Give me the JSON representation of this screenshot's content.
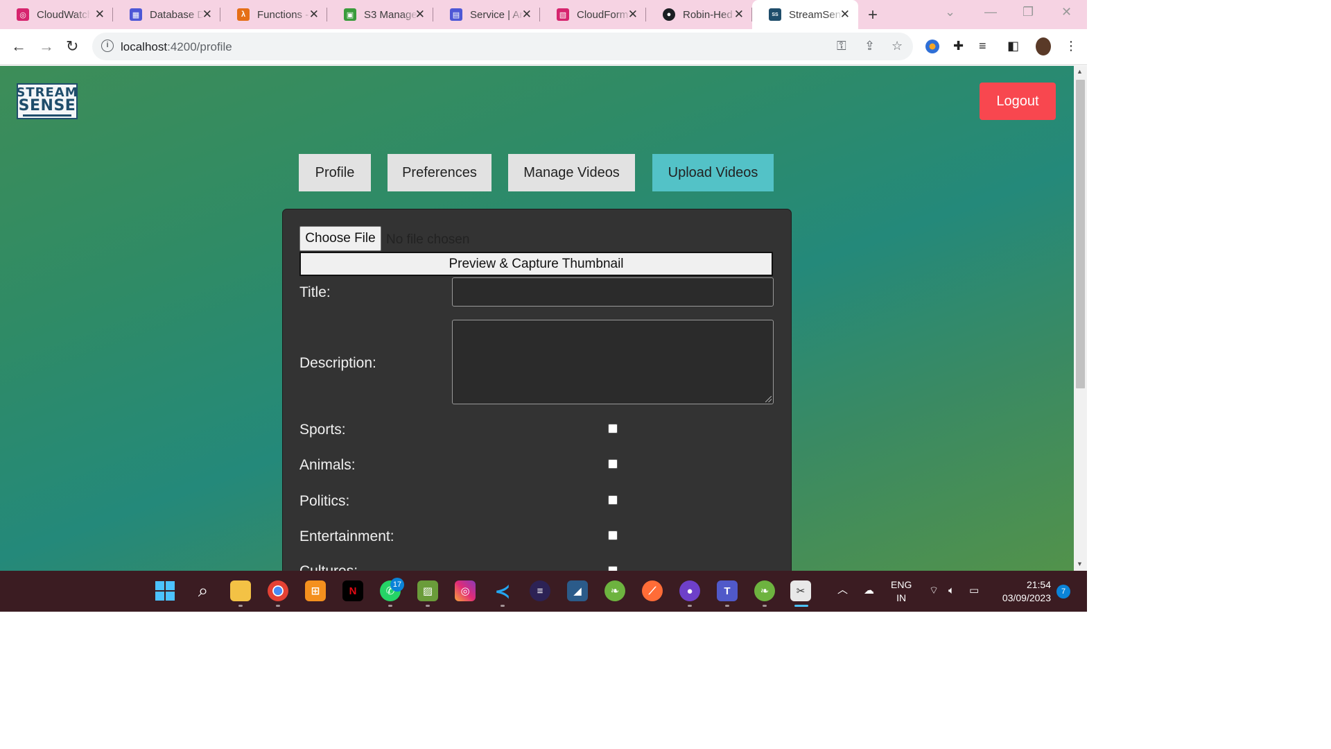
{
  "browser": {
    "tabs": [
      {
        "title": "CloudWatch",
        "icon": "cloudwatch-icon",
        "color": "#d6246e"
      },
      {
        "title": "Database D",
        "icon": "database-icon",
        "color": "#4d57d6"
      },
      {
        "title": "Functions -",
        "icon": "lambda-icon",
        "color": "#e56f17"
      },
      {
        "title": "S3 Manage",
        "icon": "s3-icon",
        "color": "#3a9b3c"
      },
      {
        "title": "Service | An",
        "icon": "service-icon",
        "color": "#4d57d6"
      },
      {
        "title": "CloudForm",
        "icon": "cloudformation-icon",
        "color": "#d6246e"
      },
      {
        "title": "Robin-Hed",
        "icon": "github-icon",
        "color": "#1b1f23"
      },
      {
        "title": "StreamSens",
        "icon": "streamsense-icon",
        "color": "#1f4d6b"
      }
    ],
    "url_host": "localhost",
    "url_path": ":4200/profile"
  },
  "app": {
    "logo_line1": "STREAM",
    "logo_line2": "SENSE",
    "logout_label": "Logout",
    "nav": [
      "Profile",
      "Preferences",
      "Manage Videos",
      "Upload Videos"
    ],
    "active_nav": "Upload Videos",
    "accent_color": "#53c2c7",
    "logout_color": "#f8474f"
  },
  "upload_form": {
    "choose_file_label": "Choose File",
    "no_file_text": "No file chosen",
    "preview_label": "Preview & Capture Thumbnail",
    "title_label": "Title:",
    "description_label": "Description:",
    "categories": [
      "Sports:",
      "Animals:",
      "Politics:",
      "Entertainment:",
      "Cultures:"
    ]
  },
  "taskbar": {
    "whatsapp_badge": "17",
    "lang_line1": "ENG",
    "lang_line2": "IN",
    "time": "21:54",
    "date": "03/09/2023",
    "notification_count": "7"
  }
}
